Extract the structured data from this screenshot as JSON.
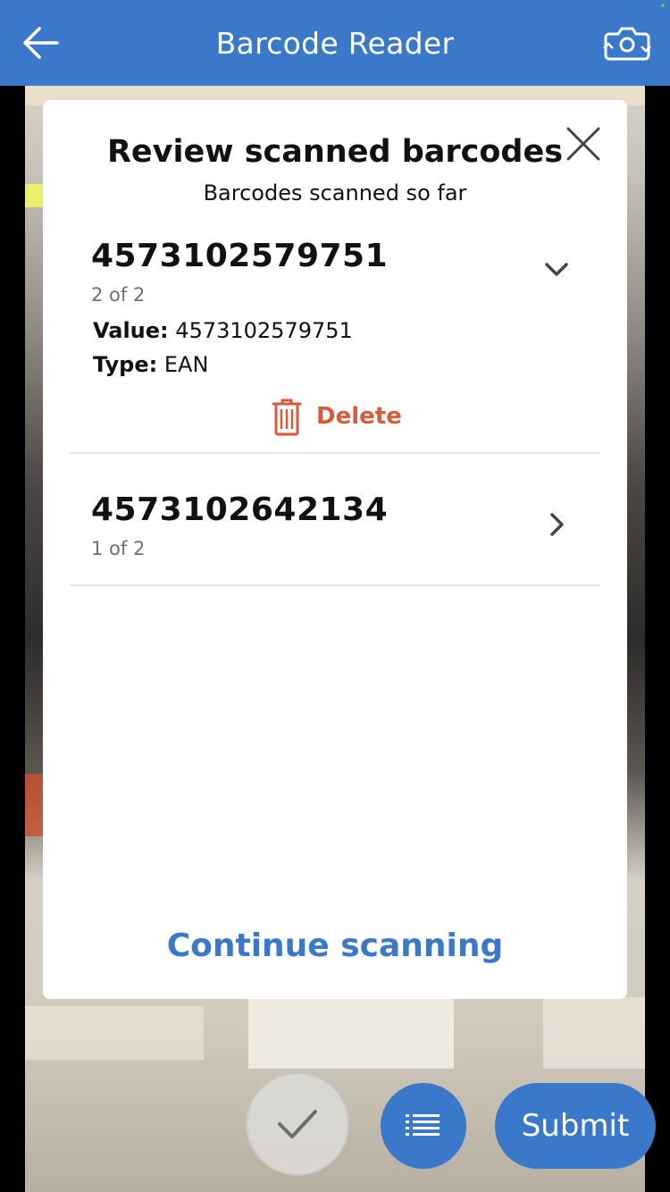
{
  "header": {
    "title": "Barcode Reader",
    "back_icon": "arrow-left-icon",
    "camera_icon": "camera-switch-icon",
    "bg_color": "#3a78c9"
  },
  "modal": {
    "title": "Review scanned barcodes",
    "subtitle": "Barcodes scanned so far",
    "close_icon": "close-icon",
    "items": [
      {
        "code": "4573102579751",
        "count": "2 of 2",
        "expanded": true,
        "value_label": "Value:",
        "value": "4573102579751",
        "type_label": "Type:",
        "type": "EAN",
        "delete_label": "Delete"
      },
      {
        "code": "4573102642134",
        "count": "1 of 2",
        "expanded": false
      }
    ],
    "continue_label": "Continue scanning"
  },
  "bottom": {
    "check_icon": "checkmark-icon",
    "list_icon": "list-icon",
    "submit_label": "Submit"
  },
  "colors": {
    "accent": "#3a78c9",
    "delete": "#d95a3a"
  }
}
